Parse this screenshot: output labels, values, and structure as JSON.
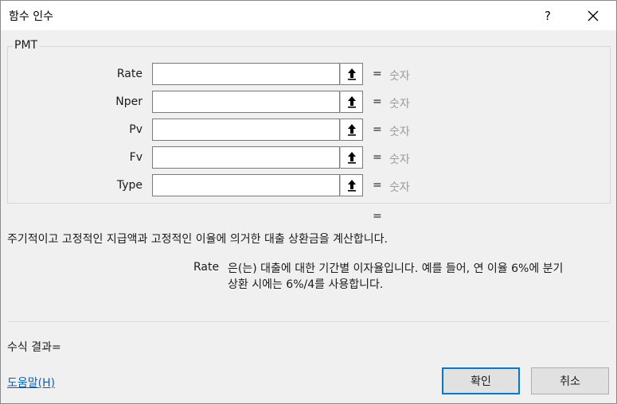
{
  "window": {
    "title": "함수 인수",
    "help_label": "?",
    "close_icon": "close-icon"
  },
  "function_group": {
    "name": "PMT",
    "arguments": [
      {
        "label": "Rate",
        "value": "",
        "equals": "=",
        "result": "숫자"
      },
      {
        "label": "Nper",
        "value": "",
        "equals": "=",
        "result": "숫자"
      },
      {
        "label": "Pv",
        "value": "",
        "equals": "=",
        "result": "숫자"
      },
      {
        "label": "Fv",
        "value": "",
        "equals": "=",
        "result": "숫자"
      },
      {
        "label": "Type",
        "value": "",
        "equals": "=",
        "result": "숫자"
      }
    ],
    "ref_icon": "range-select-icon"
  },
  "result_equals": "=",
  "description": "주기적이고 고정적인 지급액과 고정적인 이율에 의거한 대출 상환금을 계산합니다.",
  "argument_help": {
    "name": "Rate",
    "text_line1": "은(는) 대출에 대한 기간별 이자율입니다. 예를 들어, 연 이율 6%에 분기",
    "text_line2": "상환 시에는 6%/4를 사용합니다."
  },
  "formula_result": "수식 결과=",
  "help_link": "도움말(H)",
  "buttons": {
    "ok": "확인",
    "cancel": "취소"
  },
  "colors": {
    "ok_border": "#0078d7",
    "link": "#0a5fb4",
    "placeholder_value": "#9a9a9a"
  }
}
